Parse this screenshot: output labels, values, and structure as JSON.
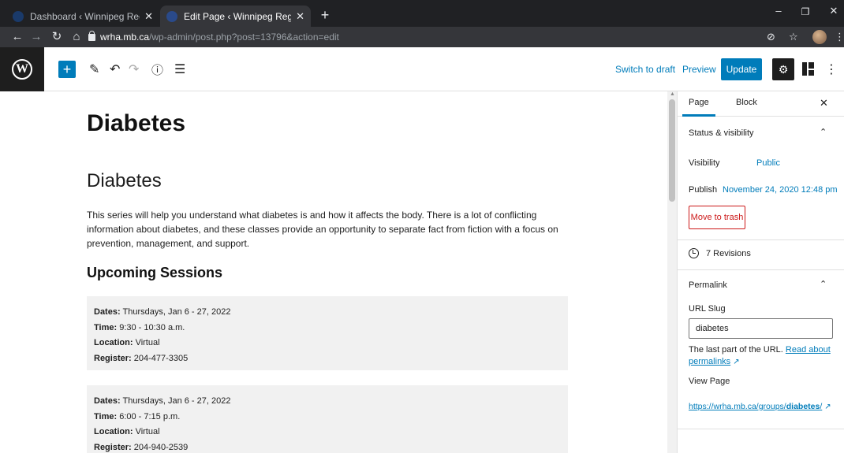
{
  "browser": {
    "tabs": [
      {
        "title": "Dashboard ‹ Winnipeg Regional H",
        "active": false
      },
      {
        "title": "Edit Page ‹ Winnipeg Regional He",
        "active": true
      }
    ],
    "tab_close": "✕",
    "new_tab": "+",
    "url_host": "wrha.mb.ca",
    "url_path": "/wp-admin/post.php?post=13796&action=edit",
    "window_controls": {
      "minimize": "–",
      "restore": "❐",
      "close": "✕"
    }
  },
  "toolbar": {
    "switch_to_draft": "Switch to draft",
    "preview": "Preview",
    "update": "Update"
  },
  "content": {
    "title": "Diabetes",
    "heading": "Diabetes",
    "paragraph": "This series will help you understand what diabetes is and how it affects the body. There is a lot of conflicting information about diabetes, and these classes provide an opportunity to separate fact from fiction with a focus on prevention, management, and support.",
    "subheading": "Upcoming Sessions",
    "sessions": [
      {
        "dates_label": "Dates:",
        "dates": "Thursdays, Jan 6 - 27, 2022",
        "time_label": "Time:",
        "time": "9:30 - 10:30 a.m.",
        "location_label": "Location:",
        "location": "Virtual",
        "register_label": "Register:",
        "register": "204-477-3305"
      },
      {
        "dates_label": "Dates:",
        "dates": "Thursdays, Jan 6 - 27, 2022",
        "time_label": "Time:",
        "time": "6:00 - 7:15 p.m.",
        "location_label": "Location:",
        "location": "Virtual",
        "register_label": "Register:",
        "register": "204-940-2539"
      }
    ]
  },
  "sidebar": {
    "tabs": [
      "Page",
      "Block"
    ],
    "close": "✕",
    "status_visibility": {
      "heading": "Status & visibility",
      "visibility_label": "Visibility",
      "visibility_value": "Public",
      "publish_label": "Publish",
      "publish_value": "November 24, 2020 12:48 pm",
      "trash": "Move to trash"
    },
    "revisions": "7 Revisions",
    "permalink": {
      "heading": "Permalink",
      "slug_label": "URL Slug",
      "slug_value": "diabetes",
      "help_text": "The last part of the URL.",
      "help_link": "Read about permalinks",
      "view_page": "View Page",
      "url_base": "https://wrha.mb.ca/groups/",
      "url_slug": "diabetes",
      "url_end": "/"
    }
  },
  "colors": {
    "accent": "#007cba",
    "danger": "#cc1818",
    "chrome_dark": "#202124",
    "wp_dark": "#1e1e1e"
  }
}
